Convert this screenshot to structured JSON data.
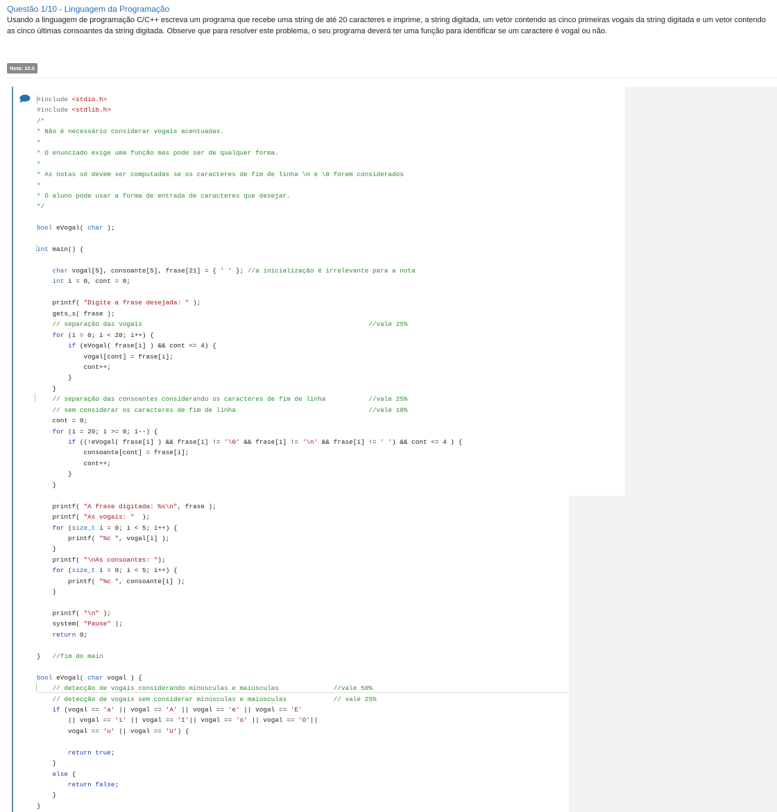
{
  "question": {
    "title": "Questão 1/10 - Linguagem da Programação",
    "text": "Usando a linguagem de programação C/C++ escreva um programa que recebe uma string de até 20 caracteres e imprime, a string digitada, um vetor contendo as cinco primeiras vogais da string digitada e um vetor contendo as cinco últimas consoantes da string digitada. Observe que para resolver este problema, o seu programa deverá ter uma função para identificar se um caractere é vogal ou não.",
    "grade": "Nota: 10.0"
  },
  "icons": {
    "comment": "speech-bubble-icon"
  },
  "colors": {
    "title": "#2a6db0",
    "border": "#5b86be",
    "keyword": "#1a3ac0",
    "string": "#a31515",
    "comment": "#2e8b2e"
  },
  "code": {
    "lines": [
      "#include <stdio.h>",
      "#include <stdlib.h>",
      "/*",
      "* Não é necessário considerar vogais acentuadas.",
      "*",
      "* O enunciado exige uma função mas pode ser de qualquer forma.",
      "*",
      "* As notas só devem ser computadas se os caracteres de fim de linha \\n e \\0 forem considerados",
      "*",
      "* O aluno pode usar a forma de entrada de caracteres que desejar.",
      "*/",
      "",
      "bool eVogal( char );",
      "",
      "int main() {",
      "",
      "    char vogal[5], consoante[5], frase[21] = { ' ' }; //a inicialização é irrelevante para a nota",
      "    int i = 0, cont = 0;",
      "",
      "    printf( \"Digite a frase desejada: \" );",
      "    gets_s( frase );",
      "    // separação das vogais                                                          //vale 25%",
      "    for (i = 0; i < 20; i++) {",
      "        if (eVogal( frase[i] ) && cont <= 4) {",
      "            vogal[cont] = frase[i];",
      "            cont++;",
      "        }",
      "    }",
      "    // separação das consoantes considerando os caracteres de fim de linha           //vale 25%",
      "    // sem considerar os caracteres de fim de linha                                  //vale 10%",
      "    cont = 0;",
      "    for (i = 20; i >= 0; i--) {",
      "        if ((!eVogal( frase[i] ) && frase[i] != '\\0' && frase[i] != '\\n' && frase[i] != ' ') && cont <= 4 ) {",
      "            consoante[cont] = frase[i];",
      "            cont++;",
      "        }",
      "    }",
      "",
      "    printf( \"A frase digitada: %s\\n\", frase );",
      "    printf( \"As vogais: \"  );",
      "    for (size_t i = 0; i < 5; i++) {",
      "        printf( \"%c \", vogal[i] );",
      "    }",
      "    printf( \"\\nAs consoantes: \");",
      "    for (size_t i = 0; i < 5; i++) {",
      "        printf( \"%c \", consoante[i] );",
      "    }",
      "",
      "    printf( \"\\n\" );",
      "    system( \"Pause\" );",
      "    return 0;",
      "",
      "}   //fim do main",
      "",
      "bool eVogal( char vogal ) {",
      "    // detecção de vogais considerando minúsculas e maiúsculas              //vale 50%",
      "    // detecção de vogais sem considerar minúsculas e maiúsculas            // vale 25%",
      "    if (vogal == 'a' || vogal == 'A' || vogal == 'e' || vogal == 'E'",
      "        || vogal == 'i' || vogal == 'I'|| vogal == 'o' || vogal == 'O'||",
      "        vogal == 'u' || vogal == 'U') {",
      "",
      "        return true;",
      "    }",
      "    else {",
      "        return false;",
      "    }",
      "}"
    ]
  }
}
